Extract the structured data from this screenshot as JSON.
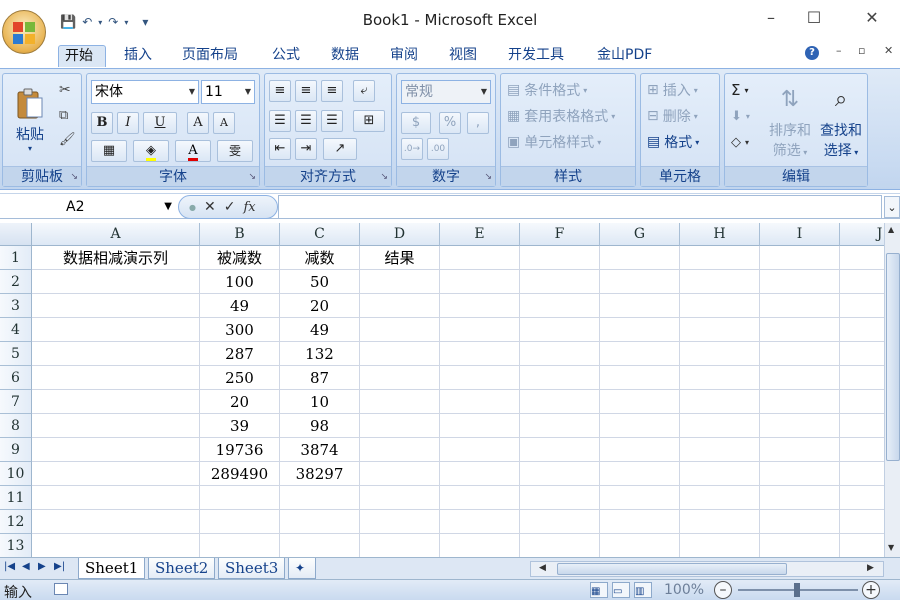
{
  "window": {
    "title": "Book1 - Microsoft Excel",
    "minimize": "–",
    "restore": "☐",
    "close": "✕"
  },
  "qat": {
    "save": "💾",
    "undo": "↶",
    "redo": "↷",
    "more": "▾"
  },
  "tabs": [
    {
      "label": "开始",
      "active": true
    },
    {
      "label": "插入"
    },
    {
      "label": "页面布局"
    },
    {
      "label": "公式"
    },
    {
      "label": "数据"
    },
    {
      "label": "审阅"
    },
    {
      "label": "视图"
    },
    {
      "label": "开发工具"
    },
    {
      "label": "金山PDF"
    }
  ],
  "ribbon": {
    "clipboard": {
      "label": "剪贴板",
      "paste": "粘贴"
    },
    "font": {
      "label": "字体",
      "name": "宋体",
      "size": "11",
      "bold": "B",
      "italic": "I",
      "underline": "U",
      "grow": "A",
      "shrink": "A",
      "color": "A",
      "phonetic": "雯"
    },
    "alignment": {
      "label": "对齐方式"
    },
    "number": {
      "label": "数字",
      "format": "常规",
      "percent": "%",
      "comma": ","
    },
    "styles": {
      "label": "样式",
      "conditional": "条件格式",
      "table": "套用表格格式",
      "cell": "单元格样式"
    },
    "cells": {
      "label": "单元格",
      "insert": "插入",
      "delete": "删除",
      "format": "格式"
    },
    "editing": {
      "label": "编辑",
      "sum": "Σ",
      "sort1": "排序和",
      "sort2": "筛选",
      "find1": "查找和",
      "find2": "选择"
    }
  },
  "formula_bar": {
    "name_box": "A2",
    "fx": "fx",
    "value": ""
  },
  "sheet": {
    "columns": [
      "A",
      "B",
      "C",
      "D",
      "E",
      "F",
      "G",
      "H",
      "I",
      "J"
    ],
    "rows": [
      [
        "数据相减演示列",
        "被减数",
        "减数",
        "结果"
      ],
      [
        "",
        "100",
        "50",
        ""
      ],
      [
        "",
        "49",
        "20",
        ""
      ],
      [
        "",
        "300",
        "49",
        ""
      ],
      [
        "",
        "287",
        "132",
        ""
      ],
      [
        "",
        "250",
        "87",
        ""
      ],
      [
        "",
        "20",
        "10",
        ""
      ],
      [
        "",
        "39",
        "98",
        ""
      ],
      [
        "",
        "19736",
        "3874",
        ""
      ],
      [
        "",
        "289490",
        "38297",
        ""
      ],
      [
        "",
        "",
        "",
        ""
      ],
      [
        "",
        "",
        "",
        ""
      ],
      [
        "",
        "",
        "",
        ""
      ]
    ],
    "row_numbers": [
      "1",
      "2",
      "3",
      "4",
      "5",
      "6",
      "7",
      "8",
      "9",
      "10",
      "11",
      "12",
      "13"
    ]
  },
  "sheet_tabs": [
    {
      "label": "Sheet1",
      "active": true
    },
    {
      "label": "Sheet2"
    },
    {
      "label": "Sheet3"
    }
  ],
  "status": {
    "mode": "输入",
    "zoom": "100%"
  }
}
